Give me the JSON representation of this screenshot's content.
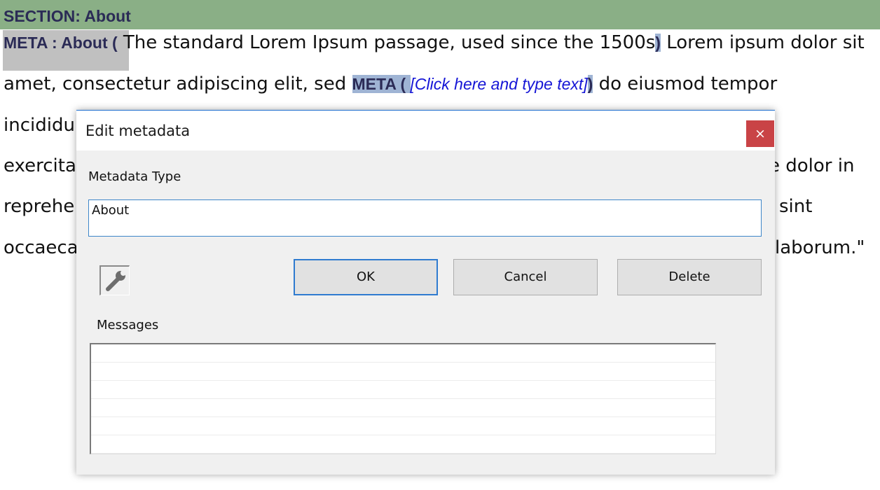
{
  "document": {
    "section_header": "SECTION: About",
    "line1": {
      "meta_tag": "META : About (",
      "text": " The standard Lorem Ipsum passage, used since the 1500s",
      "close": ")",
      "text2": " Lorem ipsum dolor sit"
    },
    "line2": {
      "text": "amet, consectetur adipiscing elit, sed ",
      "meta_tag": "META ( ",
      "placeholder": "[Click here and type text]",
      "close": ")",
      "text2": " do eiusmod tempor"
    },
    "line3_left": "incididu",
    "line4_left": "exercita",
    "line4_right": "e dolor in",
    "line5_left": "reprehe",
    "line5_right": "sint",
    "line6_left": "occaeca",
    "line6_right": "laborum.\""
  },
  "dialog": {
    "title": "Edit metadata",
    "close_glyph": "×",
    "metadata_type_label": "Metadata Type",
    "metadata_type_value": "About",
    "buttons": {
      "ok": "OK",
      "cancel": "Cancel",
      "delete": "Delete"
    },
    "messages_label": "Messages",
    "messages": [
      "",
      "",
      "",
      "",
      "",
      ""
    ]
  },
  "icons": {
    "tool_button": "wrench-icon",
    "close": "close-icon"
  },
  "colors": {
    "section_bar": "#8aaf86",
    "meta_highlight": "#9fb4d4",
    "placeholder_text": "#1515d6",
    "close_button": "#c94346",
    "default_button_border": "#2f7bd0"
  }
}
